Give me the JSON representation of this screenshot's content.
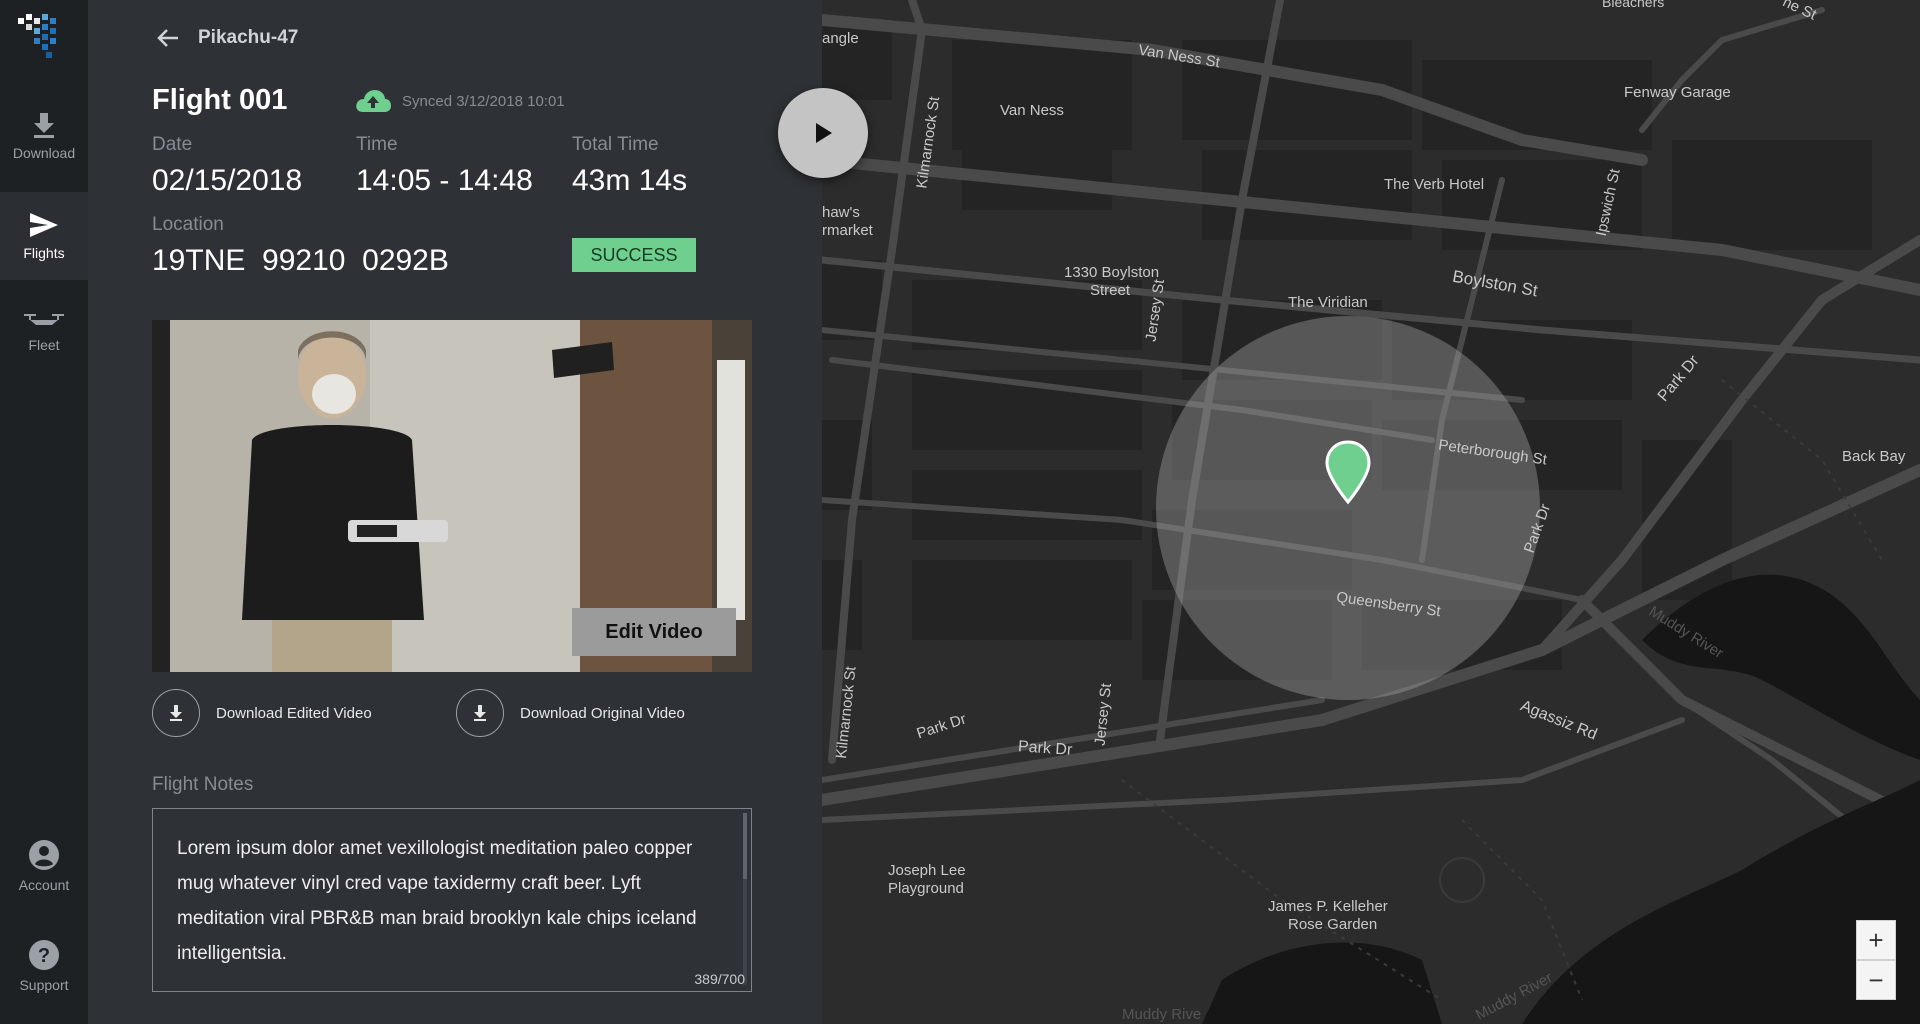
{
  "nav": {
    "items": [
      {
        "label": "Download",
        "icon": "download-icon"
      },
      {
        "label": "Flights",
        "icon": "paper-plane-icon"
      },
      {
        "label": "Fleet",
        "icon": "drone-icon"
      },
      {
        "label": "Account",
        "icon": "account-circle-icon"
      },
      {
        "label": "Support",
        "icon": "help-circle-icon"
      }
    ],
    "active": "Flights"
  },
  "header": {
    "drone_name": "Pikachu-47"
  },
  "flight": {
    "title": "Flight 001",
    "sync_status": "Synced 3/12/2018 10:01",
    "date_label": "Date",
    "date": "02/15/2018",
    "time_label": "Time",
    "time": "14:05 - 14:48",
    "total_label": "Total Time",
    "total": "43m 14s",
    "location_label": "Location",
    "location": "19TNE  99210  0292B",
    "status": "SUCCESS"
  },
  "video": {
    "edit_label": "Edit Video"
  },
  "downloads": {
    "edited": "Download Edited Video",
    "original": "Download Original Video"
  },
  "notes": {
    "label": "Flight Notes",
    "text": "Lorem ipsum dolor amet vexillologist meditation paleo copper mug whatever vinyl cred vape taxidermy craft beer. Lyft meditation viral PBR&B man braid brooklyn kale chips iceland intelligentsia.",
    "count": "389/700"
  },
  "map": {
    "labels": {
      "angle": "angle",
      "bleachers": "Bleachers",
      "ne_st": "ne St",
      "van_ness_st": "Van Ness St",
      "fenway_garage": "Fenway Garage",
      "van_ness": "Van Ness",
      "kilmarnock_st": "Kilmarnock St",
      "ipswich_st": "Ipswich St",
      "verb_hotel": "The Verb Hotel",
      "shaws": "haw's",
      "rmarket": "rmarket",
      "boylston_st": "Boylston St",
      "boylston_1330": "1330 Boylston",
      "street": "Street",
      "jersey_st": "Jersey St",
      "viridian": "The Viridian",
      "park_dr": "Park Dr",
      "peterborough_st": "Peterborough St",
      "back_bay": "Back Bay",
      "queensberry_st": "Queensberry St",
      "muddy_river": "Muddy River",
      "agassiz_rd": "Agassiz Rd",
      "joseph_lee": "Joseph Lee",
      "playground": "Playground",
      "kelleher": "James P. Kelleher",
      "rose_garden": "Rose Garden",
      "muddy_river_bottom": "Muddy Rive"
    },
    "zoom_in": "+",
    "zoom_out": "−"
  },
  "colors": {
    "accent_green": "#6fcf8f",
    "nav_bg": "#1e2124",
    "panel_bg": "#2e3236",
    "map_bg": "#2c2c2c"
  }
}
